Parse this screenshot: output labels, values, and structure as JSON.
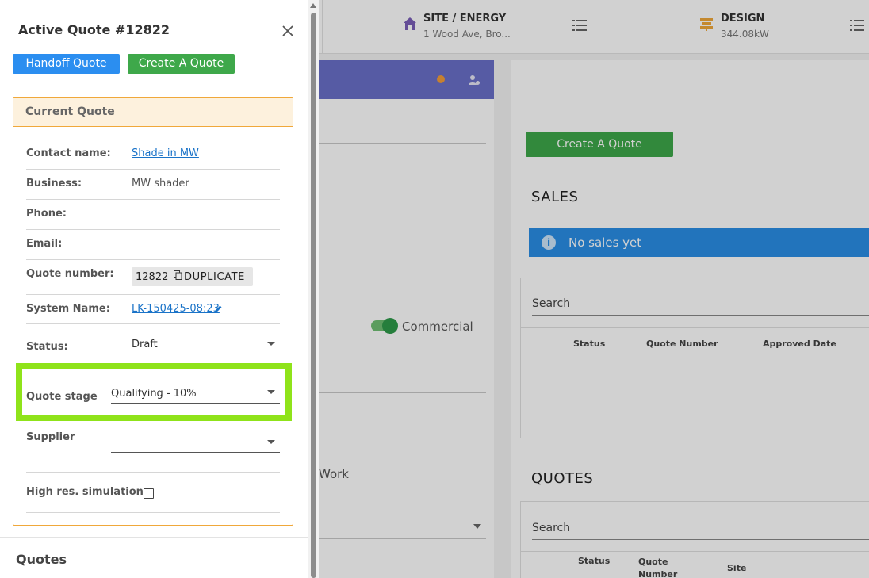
{
  "background": {
    "steps": [
      {
        "title": "SITE / ENERGY",
        "subtitle": "1 Wood Ave, Bro..."
      },
      {
        "title": "DESIGN",
        "subtitle": "344.08kW"
      }
    ],
    "left_card": {
      "toggle_label": "Commercial",
      "partial_text": "Work"
    },
    "right_card": {
      "create_button": "Create A Quote",
      "sales_title": "SALES",
      "sales_alert": "No sales yet",
      "sales_table": {
        "search_placeholder": "Search",
        "headers": [
          "Status",
          "Quote Number",
          "Approved Date"
        ]
      },
      "quotes_title": "QUOTES",
      "quotes_table": {
        "search_placeholder": "Search",
        "headers": [
          "Status",
          "Quote Number",
          "Site"
        ]
      }
    }
  },
  "drawer": {
    "title": "Active Quote #12822",
    "buttons": {
      "handoff": "Handoff Quote",
      "create": "Create A Quote"
    },
    "current_quote": {
      "heading": "Current Quote",
      "contact_name": {
        "label": "Contact name:",
        "value": "Shade in MW"
      },
      "business": {
        "label": "Business:",
        "value": "MW shader"
      },
      "phone": {
        "label": "Phone:",
        "value": ""
      },
      "email": {
        "label": "Email:",
        "value": ""
      },
      "quote_number": {
        "label": "Quote number:",
        "value": "12822",
        "duplicate": "DUPLICATE"
      },
      "system_name": {
        "label": "System Name:",
        "value": "LK-150425-08:23"
      },
      "status": {
        "label": "Status:",
        "value": "Draft"
      },
      "quote_stage": {
        "label": "Quote stage",
        "value": "Qualifying - 10%"
      },
      "supplier": {
        "label": "Supplier",
        "value": ""
      },
      "high_res": {
        "label": "High res. simulation:",
        "checked": false
      }
    },
    "quotes_heading": "Quotes"
  },
  "colors": {
    "accent_blue": "#2b8ef0",
    "accent_green": "#3ea84a",
    "box_border": "#f0a83a",
    "highlight": "#8fe31a",
    "header_purple": "#6a6fc8"
  }
}
